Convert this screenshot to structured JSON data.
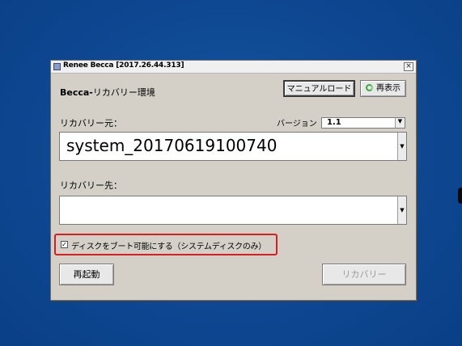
{
  "window": {
    "title": "Renee Becca [2017.26.44.313]",
    "close_glyph": "×"
  },
  "header": {
    "brand": "Becca-",
    "env_label": "リカバリー環境",
    "manual_button": "マニュアルロード",
    "reload_button": "再表示"
  },
  "source": {
    "label": "リカバリー元：",
    "value": "system_20170619100740"
  },
  "version": {
    "label": "バージョン",
    "selected": "1.1"
  },
  "destination": {
    "label": "リカバリー先：",
    "value": ""
  },
  "bootable": {
    "checked": true,
    "check_glyph": "✓",
    "label": "ディスクをブート可能にする（システムディスクのみ）"
  },
  "footer": {
    "restart_button": "再起動",
    "recover_button": "リカバリー"
  },
  "icons": {
    "reload": "refresh-icon",
    "dropdown": "dropdown-arrow-icon",
    "app": "app-icon"
  },
  "colors": {
    "desktop": "#0f4a94",
    "dialog": "#d4d0c8",
    "highlight": "#d81e1e"
  }
}
